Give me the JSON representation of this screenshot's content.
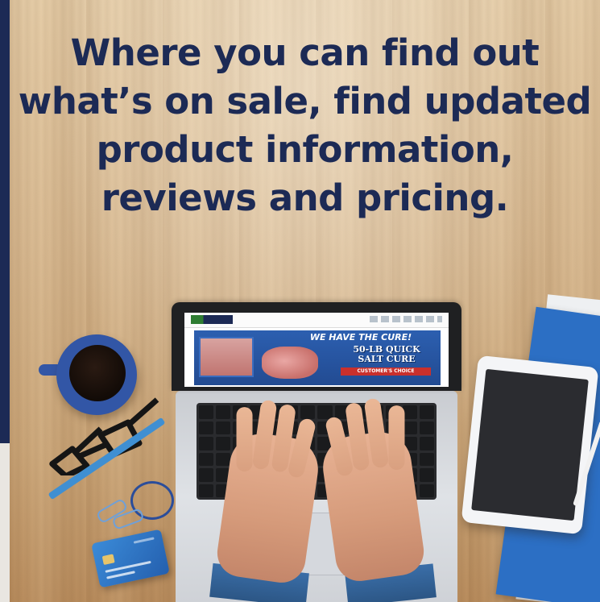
{
  "headline": {
    "lines": [
      "Where you can find out",
      "what’s on sale, find updated",
      "product information,",
      "reviews and pricing."
    ]
  },
  "laptop_site": {
    "banner_headline": "WE HAVE THE CURE!",
    "banner_sub_line1": "50-LB QUICK",
    "banner_sub_line2": "SALT CURE",
    "banner_tag": "CUSTOMER'S CHOICE"
  },
  "colors": {
    "headline": "#1c2a55",
    "accent_bar": "#1c2a55",
    "banner_blue": "#2c5fb0"
  },
  "icons": {
    "coffee": "coffee-cup-icon",
    "glasses": "eyeglasses-icon",
    "card": "credit-card-icon",
    "tablet": "tablet-icon"
  }
}
